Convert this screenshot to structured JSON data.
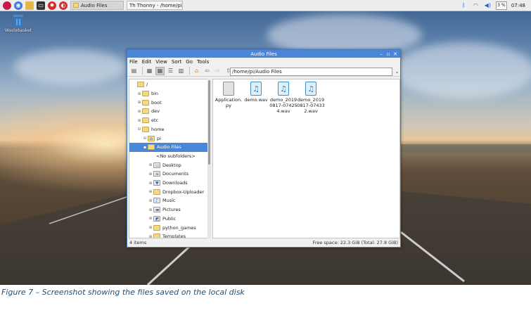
{
  "taskbar": {
    "tasks": [
      {
        "label": "Audio Files"
      },
      {
        "label": "Thonny  -  /home/pi/..."
      }
    ],
    "cpu": "3 %",
    "clock": "07:48"
  },
  "desktop": {
    "trash_label": "Wastebasket"
  },
  "window": {
    "title": "Audio Files",
    "menu": [
      "File",
      "Edit",
      "View",
      "Sort",
      "Go",
      "Tools"
    ],
    "path": "/home/pi/Audio Files",
    "tree": [
      {
        "label": "/",
        "expander": "",
        "selected": false
      },
      {
        "label": "bin",
        "expander": "⊕",
        "selected": false
      },
      {
        "label": "boot",
        "expander": "⊕",
        "selected": false
      },
      {
        "label": "dev",
        "expander": "⊕",
        "selected": false
      },
      {
        "label": "etc",
        "expander": "⊕",
        "selected": false
      },
      {
        "label": "home",
        "expander": "⊖",
        "selected": false
      },
      {
        "label": "pi",
        "expander": "⊖",
        "selected": false
      },
      {
        "label": "Audio Files",
        "expander": "▪",
        "selected": true
      },
      {
        "label": "<No subfolders>",
        "expander": "",
        "selected": false
      },
      {
        "label": "Desktop",
        "expander": "⊕",
        "selected": false
      },
      {
        "label": "Documents",
        "expander": "⊕",
        "selected": false
      },
      {
        "label": "Downloads",
        "expander": "⊕",
        "selected": false
      },
      {
        "label": "Dropbox-Uploader",
        "expander": "⊕",
        "selected": false
      },
      {
        "label": "Music",
        "expander": "⊕",
        "selected": false
      },
      {
        "label": "Pictures",
        "expander": "⊕",
        "selected": false
      },
      {
        "label": "Public",
        "expander": "⊕",
        "selected": false
      },
      {
        "label": "python_games",
        "expander": "⊕",
        "selected": false
      },
      {
        "label": "Templates",
        "expander": "⊕",
        "selected": false
      }
    ],
    "files": [
      {
        "name_line1": "Application.",
        "name_line2": "py",
        "name_line3": "",
        "kind": "text"
      },
      {
        "name_line1": "demo.wav",
        "name_line2": "",
        "name_line3": "",
        "kind": "audio"
      },
      {
        "name_line1": "demo_2019",
        "name_line2": "0817-07425",
        "name_line3": "4.wav",
        "kind": "audio"
      },
      {
        "name_line1": "demo_2019",
        "name_line2": "0817-07433",
        "name_line3": "2.wav",
        "kind": "audio"
      }
    ],
    "status_left": "4 items",
    "status_right": "Free space: 22.3 GiB (Total: 27.8 GiB)"
  },
  "caption": "Figure 7  – Screenshot showing the files saved on the local disk"
}
